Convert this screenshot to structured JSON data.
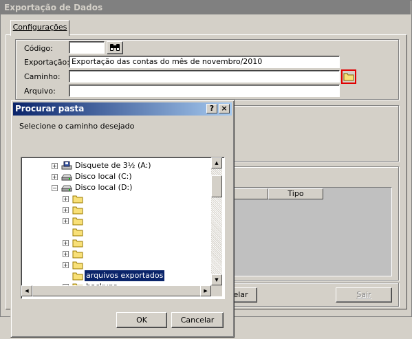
{
  "window": {
    "title": "Exportação de Dados"
  },
  "tab": {
    "label": "Configurações"
  },
  "form": {
    "codigo_label": "Código:",
    "codigo_value": "",
    "exportacao_label": "Exportação:",
    "exportacao_value": "Exportação das contas do mês de novembro/2010",
    "caminho_label": "Caminho:",
    "caminho_value": "",
    "arquivo_label": "Arquivo:",
    "arquivo_value": ""
  },
  "grid": {
    "columns": [
      "",
      "Tipo"
    ]
  },
  "buttons": {
    "cancelar_partial": "elar",
    "sair": "Sair"
  },
  "dialog": {
    "title": "Procurar pasta",
    "help": "?",
    "close": "×",
    "prompt": "Selecione o caminho desejado",
    "tree": [
      {
        "label": "Disquete de 3½ (A:)",
        "icon": "floppy-drive-icon",
        "expander": "+"
      },
      {
        "label": "Disco local (C:)",
        "icon": "hard-drive-icon",
        "expander": "+"
      },
      {
        "label": "Disco local (D:)",
        "icon": "hard-drive-icon",
        "expander": "-"
      },
      {
        "label": "",
        "icon": "folder-icon",
        "expander": "+"
      },
      {
        "label": "",
        "icon": "folder-icon",
        "expander": "+"
      },
      {
        "label": "",
        "icon": "folder-icon",
        "expander": "+"
      },
      {
        "label": "",
        "icon": "folder-icon",
        "expander": ""
      },
      {
        "label": "",
        "icon": "folder-icon",
        "expander": "+"
      },
      {
        "label": "",
        "icon": "folder-icon",
        "expander": "+"
      },
      {
        "label": "",
        "icon": "folder-icon",
        "expander": "+"
      },
      {
        "label": "arquivos exportados",
        "icon": "folder-icon",
        "expander": "",
        "selected": true
      },
      {
        "label": "backups",
        "icon": "folder-icon",
        "expander": "+"
      }
    ],
    "ok_label": "OK",
    "cancel_label": "Cancelar"
  },
  "colors": {
    "selection": "#0a246a",
    "highlight_border": "#e00000",
    "folder": "#f8e078"
  }
}
